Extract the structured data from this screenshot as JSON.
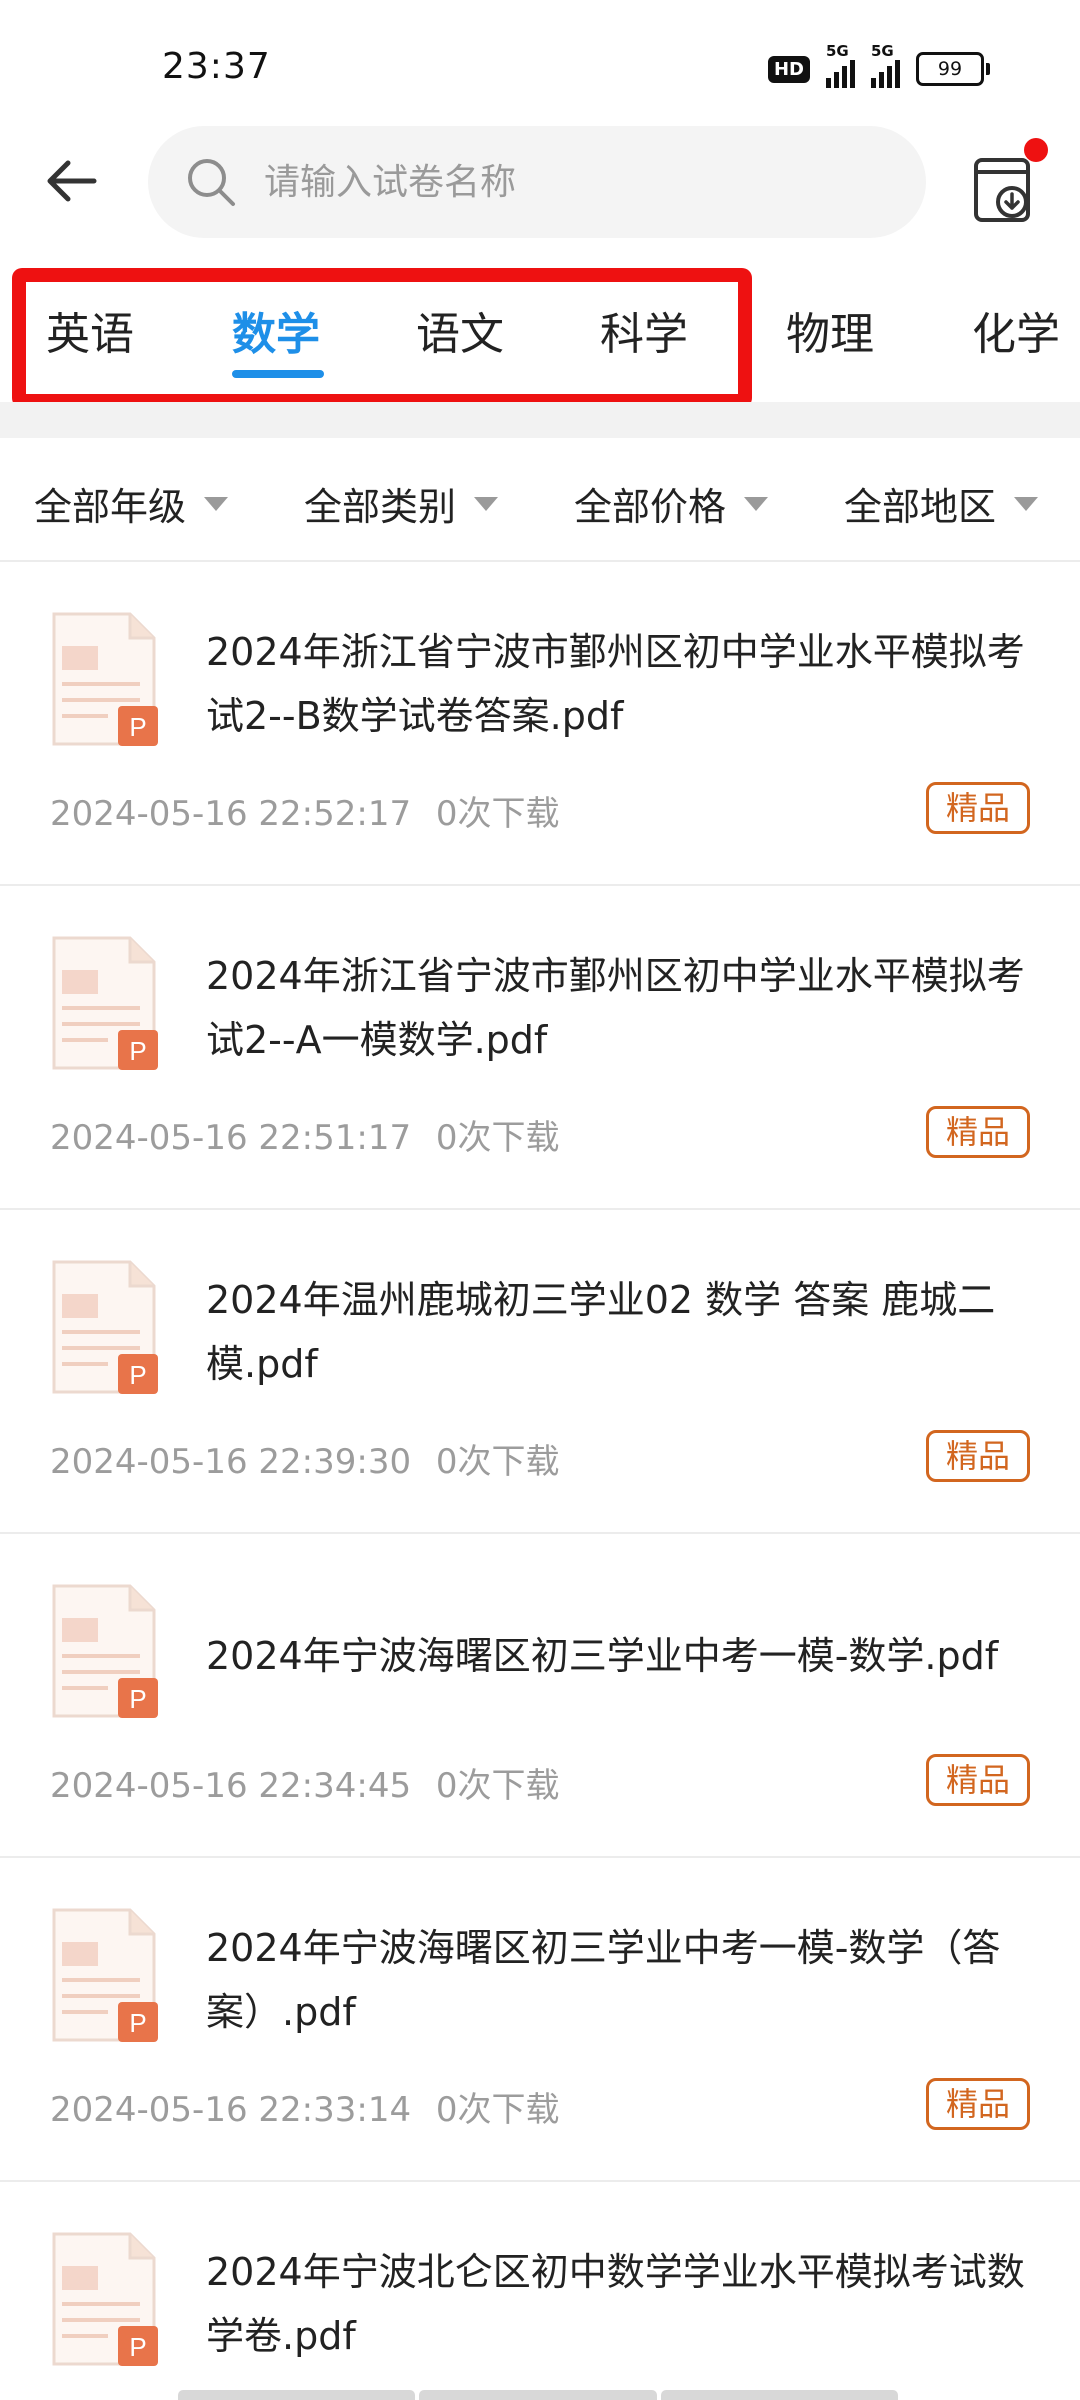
{
  "status_bar": {
    "time": "23:37",
    "hd": "HD",
    "network1": "5G",
    "network2": "5G",
    "battery": "99"
  },
  "header": {
    "search_placeholder": "请输入试卷名称",
    "download_icon": "download-box-icon",
    "notification_color": "#ee1111"
  },
  "subject_tabs": [
    {
      "label": "英语",
      "active": false
    },
    {
      "label": "数学",
      "active": true
    },
    {
      "label": "语文",
      "active": false
    },
    {
      "label": "科学",
      "active": false
    },
    {
      "label": "物理",
      "active": false
    },
    {
      "label": "化学",
      "active": false
    }
  ],
  "filters": [
    {
      "label": "全部年级"
    },
    {
      "label": "全部类别"
    },
    {
      "label": "全部价格"
    },
    {
      "label": "全部地区"
    }
  ],
  "papers": [
    {
      "title": "2024年浙江省宁波市鄞州区初中学业水平模拟考试2--B数学试卷答案.pdf",
      "datetime": "2024-05-16 22:52:17",
      "downloads": "0次下载",
      "badge": "精品"
    },
    {
      "title": "2024年浙江省宁波市鄞州区初中学业水平模拟考试2--A一模数学.pdf",
      "datetime": "2024-05-16 22:51:17",
      "downloads": "0次下载",
      "badge": "精品"
    },
    {
      "title": "2024年温州鹿城初三学业02 数学 答案 鹿城二模.pdf",
      "datetime": "2024-05-16 22:39:30",
      "downloads": "0次下载",
      "badge": "精品"
    },
    {
      "title": "2024年宁波海曙区初三学业中考一模-数学.pdf",
      "datetime": "2024-05-16 22:34:45",
      "downloads": "0次下载",
      "badge": "精品"
    },
    {
      "title": "2024年宁波海曙区初三学业中考一模-数学（答案）.pdf",
      "datetime": "2024-05-16 22:33:14",
      "downloads": "0次下载",
      "badge": "精品"
    },
    {
      "title": "2024年宁波北仑区初中数学学业水平模拟考试数学卷.pdf",
      "datetime": "",
      "downloads": "",
      "badge": ""
    }
  ],
  "file_icon_letter": "P",
  "colors": {
    "accent": "#1e8fe8",
    "badge": "#d2661f",
    "highlight": "#ee1111",
    "pdf_orange": "#e8744a"
  }
}
